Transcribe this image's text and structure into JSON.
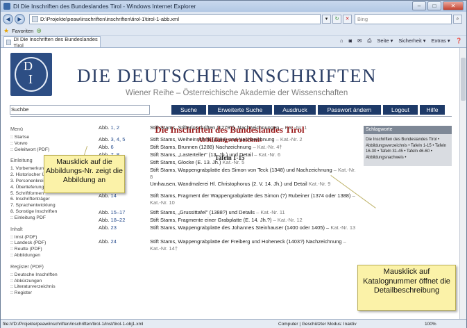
{
  "window": {
    "title": "DI Die Inschriften des Bundeslandes Tirol - Windows Internet Explorer",
    "min": "–",
    "max": "□",
    "close": "✕"
  },
  "address": {
    "url": "D:\\Projekte\\peaw\\inschriften\\inschriften\\tirol-1\\tirol-1-abb.xml",
    "search_placeholder": "Bing"
  },
  "favbar": {
    "favoriten": "Favoriten"
  },
  "tab": {
    "label": "DI Die Inschriften des Bundeslandes Tirol"
  },
  "tools": {
    "seite": "Seite ▾",
    "sicherheit": "Sicherheit ▾",
    "extras": "Extras ▾"
  },
  "header": {
    "title": "DIE DEUTSCHEN INSCHRIFTEN",
    "subtitle": "Wiener Reihe – Österreichische Akademie der Wissenschaften",
    "logo_d": "D",
    "logo_i": "I"
  },
  "search_value": "Suchbe",
  "nav": [
    "Suche",
    "Erweiterte Suche",
    "Ausdruck",
    "Passwort ändern",
    "Logout",
    "Hilfe"
  ],
  "sidebar": {
    "menu": "Menü",
    "menu_items": [
      ":: Startse",
      ":: Vorwo",
      ":: Geleitwort   (PDF)"
    ],
    "einleitung": "Einleitung",
    "einleitung_items": [
      "1.  Vorbemerkungen",
      "2.  Historischer Überblick",
      "3.  Personenkreis",
      "4.  Überlieferung",
      "5.  Schriftformen",
      "6.  Inschriftenträger",
      "7.  Sprachentwicklung",
      "8.  Sonstige Inschriften",
      ":: Einleitung PDF"
    ],
    "inhalt": "Inhalt",
    "inhalt_items": [
      ":: Imst   (PDF)",
      ":: Landeck   (PDF)",
      ":: Reutte   (PDF)",
      ":: Abbildungen"
    ],
    "register": "Register (PDF)",
    "register_items": [
      ":: Deutsche Inschriften",
      ":: Abkürzungen",
      ":: Literaturverzeichnis",
      ":: Register"
    ]
  },
  "main": {
    "title": "Die Inschriften des Bundeslandes Tirol",
    "subtitle": "Abbildungsverzeichnis",
    "tafeln": "Tafeln 1-15"
  },
  "rows": [
    {
      "abb": "Abb.",
      "nr": "1, 2",
      "text": "Stift Stams, Stifterinschriften (1279?), Nachzeichnungen",
      "kat": "– Kat.-Nr. 1"
    },
    {
      "abb": "Abb.",
      "nr": "3, 4, 5",
      "text": "Stift Stams, Weiheinschrift (1284) und Nachzeichnung",
      "kat": "– Kat.-Nr. 2"
    },
    {
      "abb": "Abb.",
      "nr": "6",
      "text": "Stift Stams, Brunnen (1288) Nachzeichnung",
      "kat": "– Kat.-Nr. 4†"
    },
    {
      "abb": "Abb.",
      "nr": "7, 8",
      "text": "Stift Stams, „Lasterteller\" (13. Jh.) und Detail",
      "kat": "– Kat.-Nr. 6"
    },
    {
      "abb": "Abb.",
      "nr": "9",
      "text": "Stift Stams, Glocke (E. 13. Jh.)",
      "kat": "Kat.-Nr. 5"
    },
    {
      "abb": "Abb.",
      "nr": "10, 11",
      "text": "Stift Stams, Wappengrabplatte des Simon von Teck (1348) und Nachzeichnung",
      "kat": "– Kat.-Nr. 8"
    },
    {
      "abb": "Abb.",
      "nr": "12, 13",
      "text": "Umhausen, Wandmalerei Hl. Christophorus (2. V. 14. Jh.) und Detail",
      "kat": "Kat.-Nr. 9"
    },
    {
      "abb": "Abb.",
      "nr": "14",
      "text": "Stift Stams, Fragment der Wappengrabplatte des Simon (?) Rubeiner (1374 oder 1388)",
      "kat": "– Kat.-Nr. 10"
    },
    {
      "abb": "Abb.",
      "nr": "15–17",
      "text": "Stift Stams, „Grussittafel\" (1388?) und Details",
      "kat": "– Kat.-Nr. 11"
    },
    {
      "abb": "Abb.",
      "nr": "18–22",
      "text": "Stift Stams, Fragmente einer Grabplatte (E. 14. Jh.?)",
      "kat": "– Kat.-Nr. 12"
    },
    {
      "abb": "Abb.",
      "nr": "23",
      "text": "Stift Stams, Wappengrabplatte des Johannes Steinhauser (1400 oder 1405) –",
      "kat": "Kat.-Nr. 13"
    },
    {
      "abb": "Abb.",
      "nr": "24",
      "text": "Stift Stams, Wappengrabplatte der Freiberg und Hoheneck (1403?) Nachzeichnung",
      "kat": "– Kat.-Nr. 14†"
    }
  ],
  "schlagworte": {
    "head": "Schlagworte",
    "body": "Die Inschriften des Bundeslandes Tirol  •  Abbildungsverzeichnis  •  Tafeln 1-15  •  Tafeln 16-30  •  Tafeln 31-45  •  Tafeln 46-60  •  Abbildungsnachweis  •"
  },
  "callouts": {
    "left": "Mausklick auf die Abbildungs-Nr. zeigt die Abbildung an",
    "right": "Mausklick auf Katalognummer öffnet die Detailbeschreibung"
  },
  "status": {
    "path": "file:///D:/Projekte/peaw/inschriften/inschriften/tirol-1/inst/tirol-1-obj1.xml",
    "zone": "Computer | Geschützter Modus: Inaktiv",
    "zoom": "100%"
  }
}
